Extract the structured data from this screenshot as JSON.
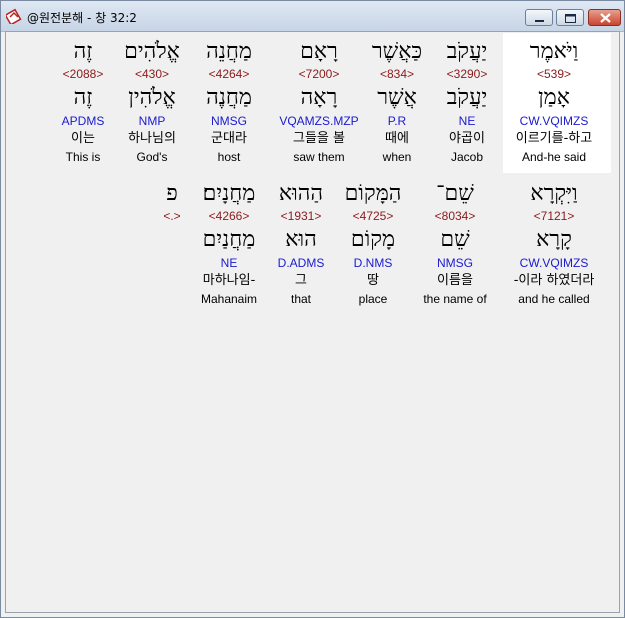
{
  "window": {
    "title": "@원전분해 - 창 32:2"
  },
  "verse_rows": [
    {
      "words": [
        {
          "heb": "וַיֹּאמֶר",
          "num": "<539>",
          "lemma": "אָמַן",
          "code": "CW.VQIMZS",
          "kor": "이르기를-하고",
          "eng": "And-he said",
          "selected": true
        },
        {
          "heb": "יַעֲקֹב",
          "num": "<3290>",
          "lemma": "יַעֲקֹב",
          "code": "NE",
          "kor": "야곱이",
          "eng": "Jacob"
        },
        {
          "heb": "כַּאֲשֶׁר",
          "num": "<834>",
          "lemma": "אֲשֶׁר",
          "code": "P.R",
          "kor": "때에",
          "eng": "when"
        },
        {
          "heb": "רָאָם",
          "num": "<7200>",
          "lemma": "רָאָה",
          "code": "VQAMZS.MZP",
          "kor": "그들을 볼",
          "eng": "saw them"
        },
        {
          "heb": "מַחֲנֵה",
          "num": "<4264>",
          "lemma": "מַחֲנֶה",
          "code": "NMSG",
          "kor": "군대라",
          "eng": "host"
        },
        {
          "heb": "אֱלֹהִים",
          "num": "<430>",
          "lemma": "אֱלֹהִין",
          "code": "NMP",
          "kor": "하나님의",
          "eng": "God's"
        },
        {
          "heb": "זֶה",
          "num": "<2088>",
          "lemma": "זֶה",
          "code": "APDMS",
          "kor": "이는",
          "eng": "This is"
        }
      ]
    },
    {
      "words": [
        {
          "heb": "וַיִּקְרָא",
          "num": "<7121>",
          "lemma": "קָרָא",
          "code": "CW.VQIMZS",
          "kor": "-이라 하였더라",
          "eng": "and he called"
        },
        {
          "heb": "שֵׁם־",
          "num": "<8034>",
          "lemma": "שֵׁם",
          "code": "NMSG",
          "kor": "이름을",
          "eng": "the name of"
        },
        {
          "heb": "הַמָּקוֹם",
          "num": "<4725>",
          "lemma": "מָקוֹם",
          "code": "D.NMS",
          "kor": "땅",
          "eng": "place"
        },
        {
          "heb": "הַהוּא",
          "num": "<1931>",
          "lemma": "הוּא",
          "code": "D.ADMS",
          "kor": "그",
          "eng": "that"
        },
        {
          "heb": "מַחֲנָיִם׃",
          "num": "<4266>",
          "lemma": "מַחֲנַיִם",
          "code": "NE",
          "kor": "마하나임-",
          "eng": "Mahanaim"
        },
        {
          "heb": "פ",
          "num": "<.>",
          "lemma": "",
          "code": "",
          "kor": "",
          "eng": ""
        }
      ]
    }
  ]
}
